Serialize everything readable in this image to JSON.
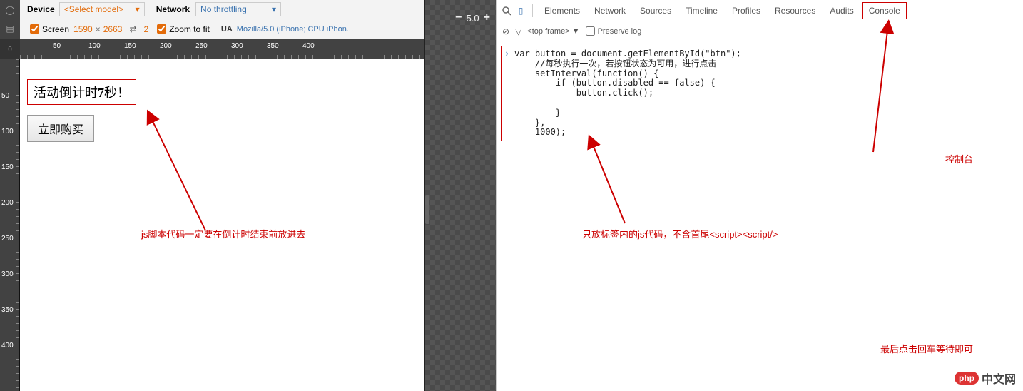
{
  "device_toolbar": {
    "device_label": "Device",
    "select_model": "<Select model>",
    "network_label": "Network",
    "network_value": "No throttling",
    "ua_label": "UA",
    "ua_value": "Mozilla/5.0 (iPhone; CPU iPhon...",
    "screen_label": "Screen",
    "screen_w": "1590",
    "screen_h": "2663",
    "pixel_ratio": "2",
    "zoom_label": "Zoom to fit"
  },
  "ruler_h": [
    "0",
    "50",
    "100",
    "150",
    "200",
    "250",
    "300",
    "350",
    "400"
  ],
  "ruler_v": [
    "0",
    "50",
    "100",
    "150",
    "200",
    "250",
    "300",
    "350",
    "400"
  ],
  "page": {
    "countdown_prefix": "活动倒计时",
    "countdown_num": "7",
    "countdown_suffix": "秒！",
    "buy_button": "立即购买"
  },
  "zoom": {
    "minus": "−",
    "value": "5.0",
    "plus": "+"
  },
  "annotations": {
    "left_note": "js脚本代码一定要在倒计时结束前放进去",
    "right_note1": "只放标签内的js代码，不含首尾<script><script/>",
    "right_note2": "控制台",
    "right_note3": "最后点击回车等待即可"
  },
  "devtools": {
    "tabs": [
      "Elements",
      "Network",
      "Sources",
      "Timeline",
      "Profiles",
      "Resources",
      "Audits",
      "Console"
    ],
    "active_tab": "Console",
    "top_frame": "<top frame>",
    "preserve_log": "Preserve log",
    "code": "var button = document.getElementById(\"btn\");\n    //每秒执行一次，若按钮状态为可用，进行点击\n    setInterval(function() {\n        if (button.disabled == false) {\n            button.click();\n\n        }\n    },\n    1000);"
  },
  "watermark": {
    "logo": "php",
    "text": "中文网"
  }
}
